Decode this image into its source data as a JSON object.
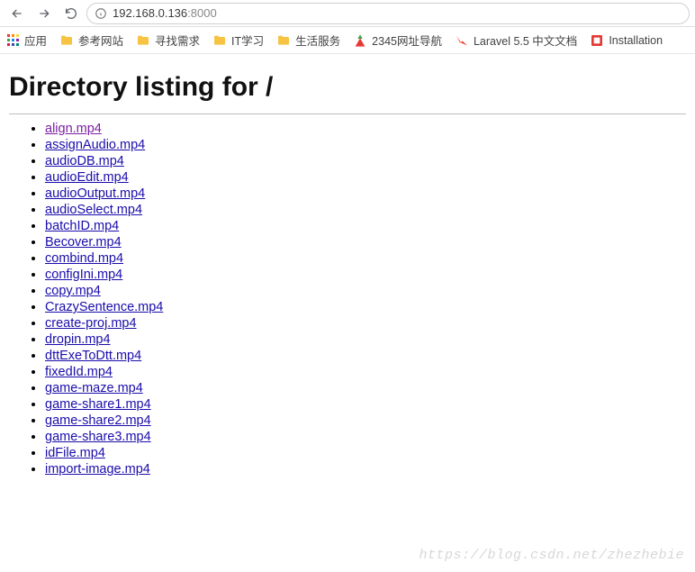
{
  "address": {
    "host": "192.168.0.136",
    "port": ":8000"
  },
  "bookmarks": {
    "apps": "应用",
    "items": [
      {
        "label": "参考网站",
        "icon": "folder"
      },
      {
        "label": "寻找需求",
        "icon": "folder"
      },
      {
        "label": "IT学习",
        "icon": "folder"
      },
      {
        "label": "生活服务",
        "icon": "folder"
      },
      {
        "label": "2345网址导航",
        "icon": "nav2345"
      },
      {
        "label": "Laravel 5.5 中文文档",
        "icon": "laravel"
      },
      {
        "label": "Installation",
        "icon": "install"
      }
    ]
  },
  "page": {
    "title": "Directory listing for /",
    "files": [
      {
        "name": "align.mp4",
        "visited": true
      },
      {
        "name": "assignAudio.mp4",
        "visited": false
      },
      {
        "name": "audioDB.mp4",
        "visited": false
      },
      {
        "name": "audioEdit.mp4",
        "visited": false
      },
      {
        "name": "audioOutput.mp4",
        "visited": false
      },
      {
        "name": "audioSelect.mp4",
        "visited": false
      },
      {
        "name": "batchID.mp4",
        "visited": false
      },
      {
        "name": "Becover.mp4",
        "visited": false
      },
      {
        "name": "combind.mp4",
        "visited": false
      },
      {
        "name": "configIni.mp4",
        "visited": false
      },
      {
        "name": "copy.mp4",
        "visited": false
      },
      {
        "name": "CrazySentence.mp4",
        "visited": false
      },
      {
        "name": "create-proj.mp4",
        "visited": false
      },
      {
        "name": "dropin.mp4",
        "visited": false
      },
      {
        "name": "dttExeToDtt.mp4",
        "visited": false
      },
      {
        "name": "fixedId.mp4",
        "visited": false
      },
      {
        "name": "game-maze.mp4",
        "visited": false
      },
      {
        "name": "game-share1.mp4",
        "visited": false
      },
      {
        "name": "game-share2.mp4",
        "visited": false
      },
      {
        "name": "game-share3.mp4",
        "visited": false
      },
      {
        "name": "idFile.mp4",
        "visited": false
      },
      {
        "name": "import-image.mp4",
        "visited": false
      }
    ]
  },
  "watermark": "https://blog.csdn.net/zhezhebie"
}
